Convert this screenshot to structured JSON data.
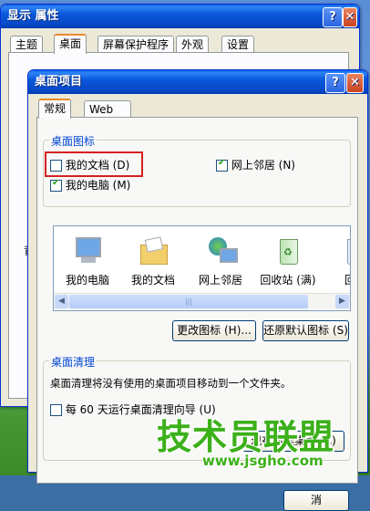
{
  "back_window": {
    "title": "显示 属性",
    "tabs": [
      "主题",
      "桌面",
      "屏幕保护程序",
      "外观",
      "设置"
    ],
    "partial_text": "背"
  },
  "dialog": {
    "title": "桌面项目",
    "tabs": [
      "常规",
      "Web"
    ],
    "desktop_icons": {
      "legend": "桌面图标",
      "checkboxes": [
        {
          "label": "我的文档 (D)",
          "checked": false
        },
        {
          "label": "网上邻居 (N)",
          "checked": true
        },
        {
          "label": "我的电脑 (M)",
          "checked": true
        }
      ]
    },
    "icons": [
      "我的电脑",
      "我的文档",
      "网上邻居",
      "回收站 (满)",
      "回收"
    ],
    "buttons": {
      "change_icon": "更改图标 (H)...",
      "restore_default": "还原默认图标 (S)",
      "cleanup_now": "现在清理桌面 (C)"
    },
    "cleanup": {
      "legend": "桌面清理",
      "description": "桌面清理将没有使用的桌面项目移动到一个文件夹。",
      "checkbox_label": "每 60 天运行桌面清理向导 (U)",
      "checkbox_checked": false
    }
  },
  "watermark": {
    "title": "技术员联盟",
    "url": "www.jsgho.com"
  },
  "partial_bottom_button": "消",
  "colors": {
    "highlight_box": "#d42020",
    "watermark_green": "#3cb01a"
  }
}
